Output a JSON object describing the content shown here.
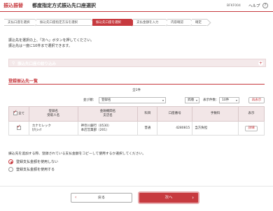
{
  "header": {
    "category": "振込振替",
    "title": "都度指定方式振込先口座選択",
    "screen_code": "BFKF004",
    "help_label": "ヘルプ",
    "help_icon": "?"
  },
  "steps": [
    "支払口座を選択",
    "振込先口座指定方法を選択",
    "振込先口座を選択",
    "支払金額を入力",
    "内容確認",
    "確定"
  ],
  "intro_lines": [
    "振込先を選択の上、「次へ」ボタンを押してください。",
    "振込先は一度に10件まで選択できます。"
  ],
  "filter_bar": {
    "label": "振込先口座の絞り込み",
    "toggle_icon": "+"
  },
  "list": {
    "section_title": "登録振込先一覧",
    "count": "全1件",
    "sort_label": "並び順：",
    "sort_value": "登録名",
    "order_value": "昇順",
    "per_page_label": "表示件数：",
    "per_page_value": "10件",
    "redisplay_label": "再表示",
    "headers": {
      "all": "全て",
      "name_line1": "登録名",
      "name_line2": "受取人名",
      "bank_line1": "金融機関名",
      "bank_line2": "支店名",
      "subject": "科目",
      "account": "口座番号",
      "fee": "手数料",
      "display": "表示"
    },
    "rows": [
      {
        "checked": true,
        "name": "カナヒレック",
        "payee": "ｶﾅﾋﾚｯｸ",
        "bank": "神奈川銀行（0530）",
        "branch": "本店営業部（201）",
        "subject": "普通",
        "account": "4280815",
        "fee": "当方負担",
        "detail_label": "詳細"
      }
    ]
  },
  "amount_option": {
    "note": "振込先を追加する際、登録されている支払金額をコピーして使用するか選択してください。",
    "options": [
      {
        "label": "登録支払金額を使用しない",
        "selected": true
      },
      {
        "label": "登録支払金額を使用する",
        "selected": false
      }
    ]
  },
  "buttons": {
    "back": "戻る",
    "next": "次へ"
  },
  "colors": {
    "accent": "#c73a3f",
    "accent_light": "#f4e9ea"
  }
}
